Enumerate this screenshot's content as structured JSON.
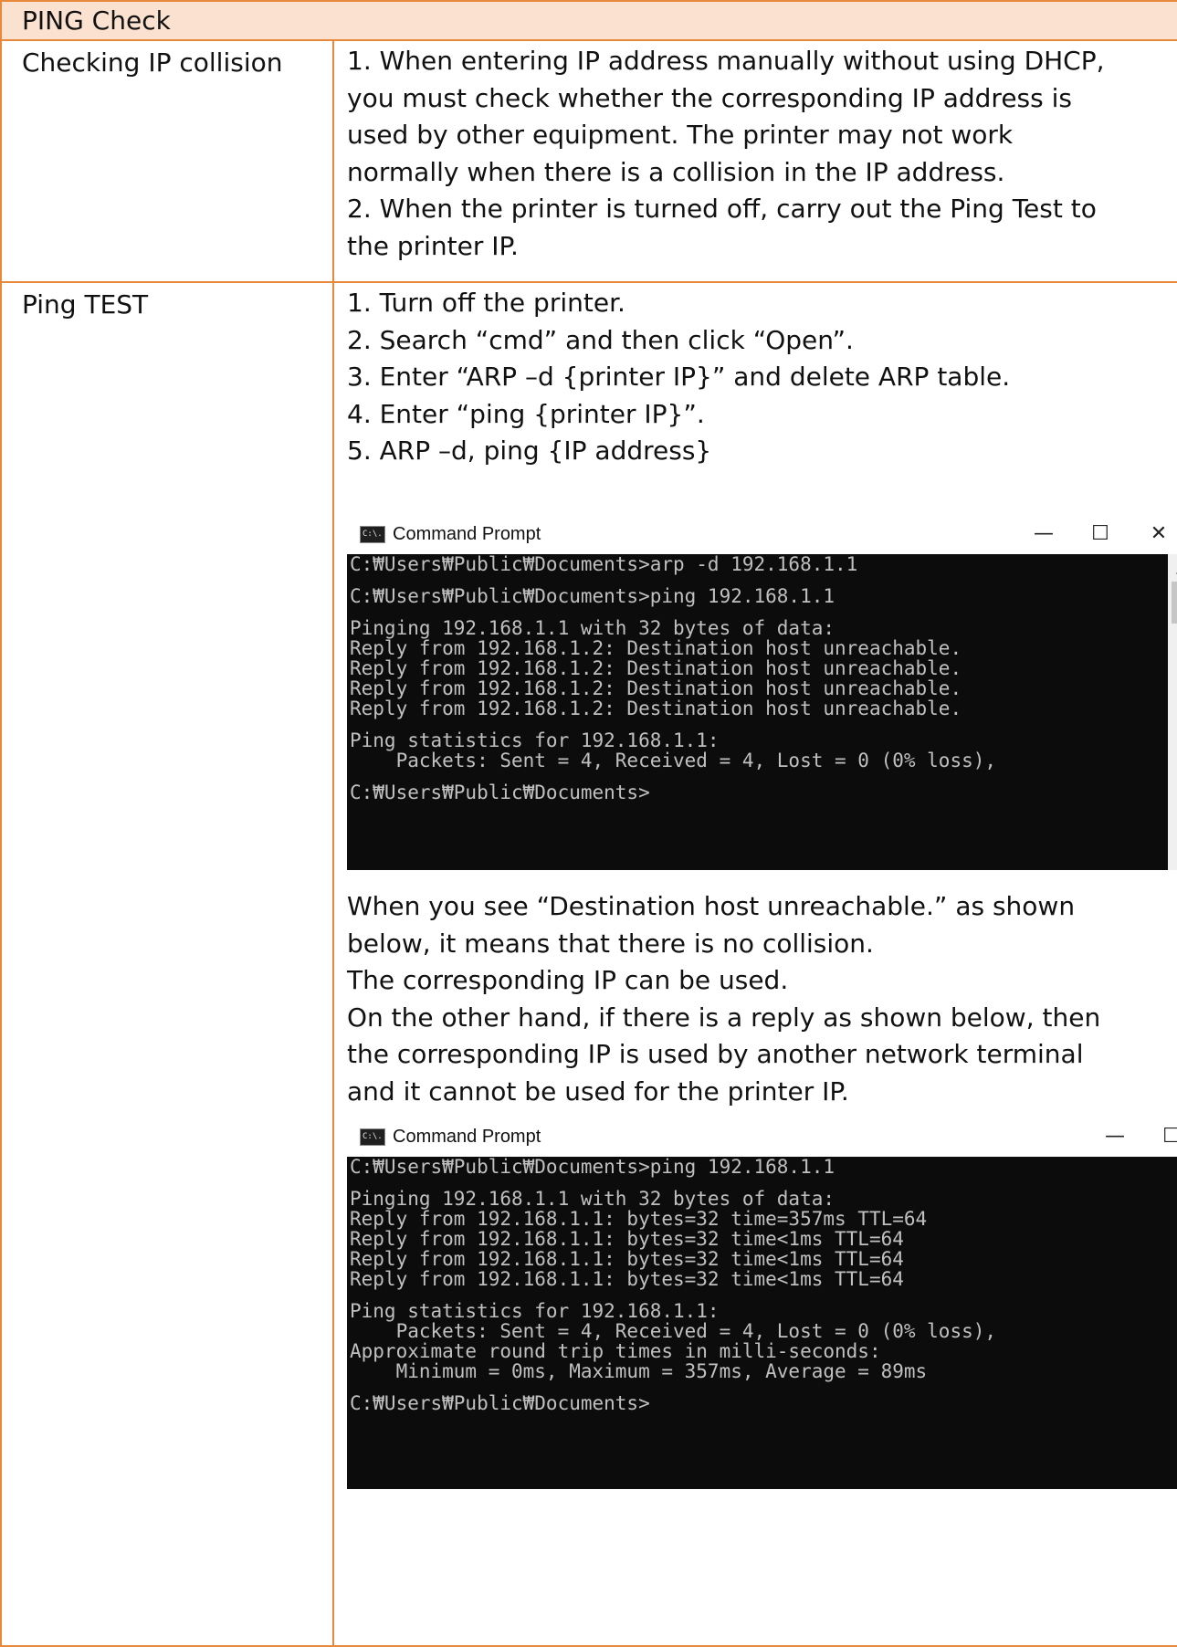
{
  "header": {
    "title": "PING Check"
  },
  "rows": [
    {
      "label": "Checking IP collision",
      "lines": [
        "1. When entering IP address manually without using DHCP,",
        "you must check whether the corresponding IP address is",
        "used by other equipment. The printer may not work",
        "normally when there is a collision in the IP address.",
        "2. When the printer is turned off, carry out the Ping Test to",
        "the printer IP."
      ]
    },
    {
      "label": "Ping TEST",
      "steps": [
        "1. Turn off the printer.",
        "2. Search “cmd” and then click “Open”.",
        "3. Enter “ARP –d {printer IP}” and delete ARP table.",
        "4. Enter “ping {printer IP}”.",
        "5. ARP –d, ping {IP address}"
      ],
      "explanation": [
        "When you see “Destination host unreachable.” as shown",
        "below, it means that there is no collision.",
        "The corresponding IP can be used.",
        "On the other hand, if there is a reply as shown below, then",
        "the corresponding IP is used by another network terminal",
        "and it cannot be used for the printer IP."
      ]
    }
  ],
  "cmd_windows": [
    {
      "title": "Command Prompt",
      "icon_text": "C:\\.",
      "minimize": "—",
      "maximize": "☐",
      "close": "✕",
      "lines": [
        "C:₩Users₩Public₩Documents>arp -d 192.168.1.1",
        "",
        "C:₩Users₩Public₩Documents>ping 192.168.1.1",
        "",
        "Pinging 192.168.1.1 with 32 bytes of data:",
        "Reply from 192.168.1.2: Destination host unreachable.",
        "Reply from 192.168.1.2: Destination host unreachable.",
        "Reply from 192.168.1.2: Destination host unreachable.",
        "Reply from 192.168.1.2: Destination host unreachable.",
        "",
        "Ping statistics for 192.168.1.1:",
        "    Packets: Sent = 4, Received = 4, Lost = 0 (0% loss),",
        "",
        "C:₩Users₩Public₩Documents>"
      ]
    },
    {
      "title": "Command Prompt",
      "icon_text": "C:\\.",
      "minimize": "—",
      "maximize": "☐",
      "lines": [
        "C:₩Users₩Public₩Documents>ping 192.168.1.1",
        "",
        "Pinging 192.168.1.1 with 32 bytes of data:",
        "Reply from 192.168.1.1: bytes=32 time=357ms TTL=64",
        "Reply from 192.168.1.1: bytes=32 time<1ms TTL=64",
        "Reply from 192.168.1.1: bytes=32 time<1ms TTL=64",
        "Reply from 192.168.1.1: bytes=32 time<1ms TTL=64",
        "",
        "Ping statistics for 192.168.1.1:",
        "    Packets: Sent = 4, Received = 4, Lost = 0 (0% loss),",
        "Approximate round trip times in milli-seconds:",
        "    Minimum = 0ms, Maximum = 357ms, Average = 89ms",
        "",
        "C:₩Users₩Public₩Documents>"
      ]
    }
  ]
}
